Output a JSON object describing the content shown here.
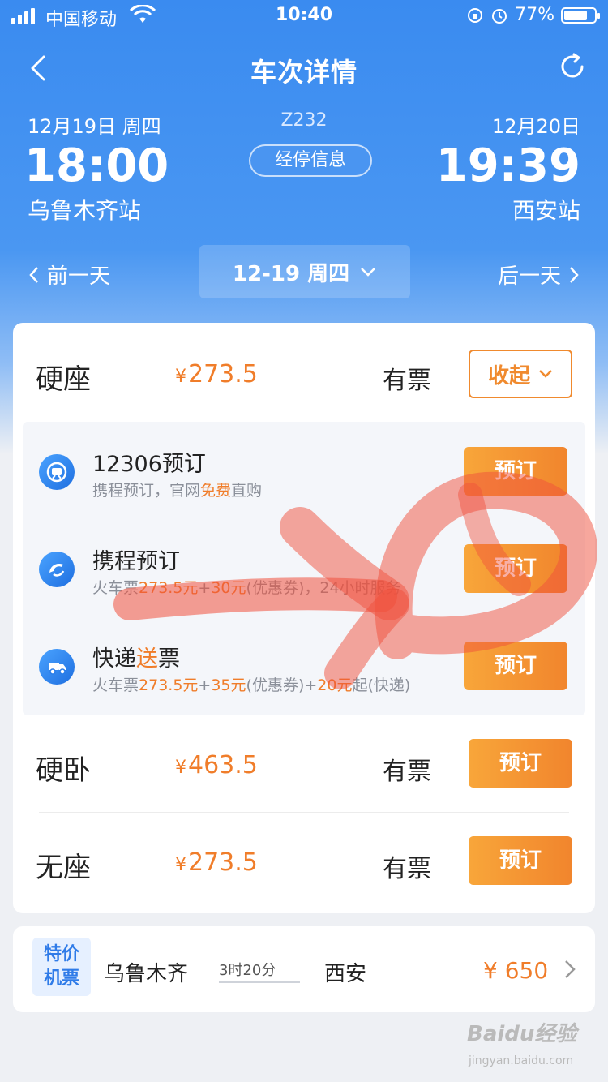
{
  "status_bar": {
    "carrier": "中国移动",
    "time": "10:40",
    "battery": "77%"
  },
  "nav": {
    "title": "车次详情"
  },
  "trip": {
    "train_no": "Z232",
    "departure": {
      "date": "12月19日  周四",
      "time": "18:00",
      "station": "乌鲁木齐站"
    },
    "arrival": {
      "date": "12月20日",
      "time": "19:39",
      "station": "西安站"
    },
    "stops_label": "经停信息"
  },
  "day_switch": {
    "prev": "前一天",
    "current": "12-19  周四",
    "next": "后一天"
  },
  "seats": [
    {
      "name": "硬座",
      "price": "273.5",
      "yen": "¥",
      "availability": "有票",
      "action": "收起"
    },
    {
      "name": "硬卧",
      "price": "463.5",
      "yen": "¥",
      "availability": "有票",
      "action": "预订"
    },
    {
      "name": "无座",
      "price": "273.5",
      "yen": "¥",
      "availability": "有票",
      "action": "预订"
    }
  ],
  "booking_options": [
    {
      "title": "12306预订",
      "desc_pre": "携程预订，官网",
      "desc_hl": "免费",
      "desc_post": "直购",
      "button": "预订"
    },
    {
      "title": "携程预订",
      "desc": "火车票273.5元+30元(优惠券)，24小时服务",
      "button": "预订"
    },
    {
      "title_pre": "快递",
      "title_hl": "送",
      "title_post": "票",
      "desc": "火车票273.5元+35元(优惠券)+20元起(快递)",
      "button": "预订"
    }
  ],
  "flight_promo": {
    "tag_line1": "特价",
    "tag_line2": "机票",
    "from": "乌鲁木齐",
    "duration": "3时20分",
    "to": "西安",
    "price": "¥ 650"
  },
  "watermark": {
    "brand": "Baidu经验",
    "url": "jingyan.baidu.com"
  },
  "colors": {
    "accent": "#f07d2a",
    "header_blue": "#3a8bf0",
    "annotation_red": "#f0503c"
  }
}
